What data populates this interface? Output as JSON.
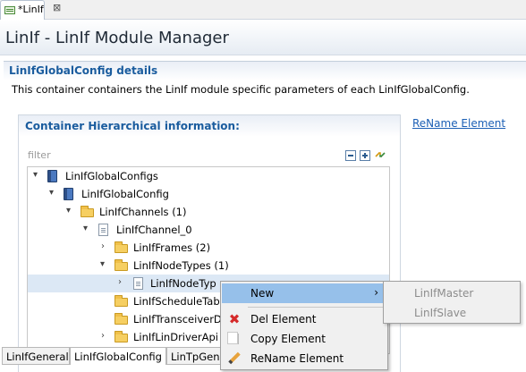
{
  "editor_tab": {
    "title": "*LinIf",
    "close": "⊠"
  },
  "page": {
    "title": "LinIf - LinIf Module Manager"
  },
  "details": {
    "title": "LinIfGlobalConfig details",
    "description": "This container containers the LinIf module specific parameters of each LinIfGlobalConfig."
  },
  "hierarchy": {
    "title": "Container Hierarchical information:",
    "rename_link": "ReName Element",
    "filter_placeholder": "filter",
    "toolbar_icons": [
      "collapse-all-icon",
      "expand-all-icon",
      "link-editor-icon"
    ]
  },
  "tree": [
    {
      "label": "LinIfGlobalConfigs",
      "icon": "book-icon",
      "expander": "▾"
    },
    {
      "label": "LinIfGlobalConfig",
      "icon": "book-icon",
      "expander": "▾"
    },
    {
      "label": "LinIfChannels (1)",
      "icon": "folder-icon",
      "expander": "▾"
    },
    {
      "label": "LinIfChannel_0",
      "icon": "page-icon",
      "expander": "▾"
    },
    {
      "label": "LinIfFrames (2)",
      "icon": "folder-icon",
      "expander": "›"
    },
    {
      "label": "LinIfNodeTypes (1)",
      "icon": "folder-icon",
      "expander": "▾"
    },
    {
      "label": "LinIfNodeTyp",
      "icon": "page-icon",
      "expander": "›",
      "selected": true
    },
    {
      "label": "LinIfScheduleTab",
      "icon": "folder-icon",
      "expander": ""
    },
    {
      "label": "LinIfTransceiverD",
      "icon": "folder-icon",
      "expander": ""
    },
    {
      "label": "LinIfLinDriverApi",
      "icon": "folder-icon",
      "expander": "›"
    }
  ],
  "bottom_tabs": [
    {
      "label": "LinIfGeneral",
      "active": false
    },
    {
      "label": "LinIfGlobalConfig",
      "active": true
    },
    {
      "label": "LinTpGen",
      "active": false
    }
  ],
  "context_menu": {
    "items": [
      {
        "label": "New",
        "submenu_arrow": "›",
        "highlighted": true
      },
      {
        "label": "Del Element",
        "icon": "delete-icon"
      },
      {
        "label": "Copy Element",
        "icon": "copy-icon"
      },
      {
        "label": "ReName Element",
        "icon": "pencil-icon"
      }
    ],
    "submenu": [
      "LinIfMaster",
      "LinIfSlave"
    ]
  },
  "colors": {
    "section_title": "#1a5c9e",
    "link": "#1b5fb5",
    "menu_highlight": "#96c0ea",
    "delete_icon": "#d52a2a"
  }
}
